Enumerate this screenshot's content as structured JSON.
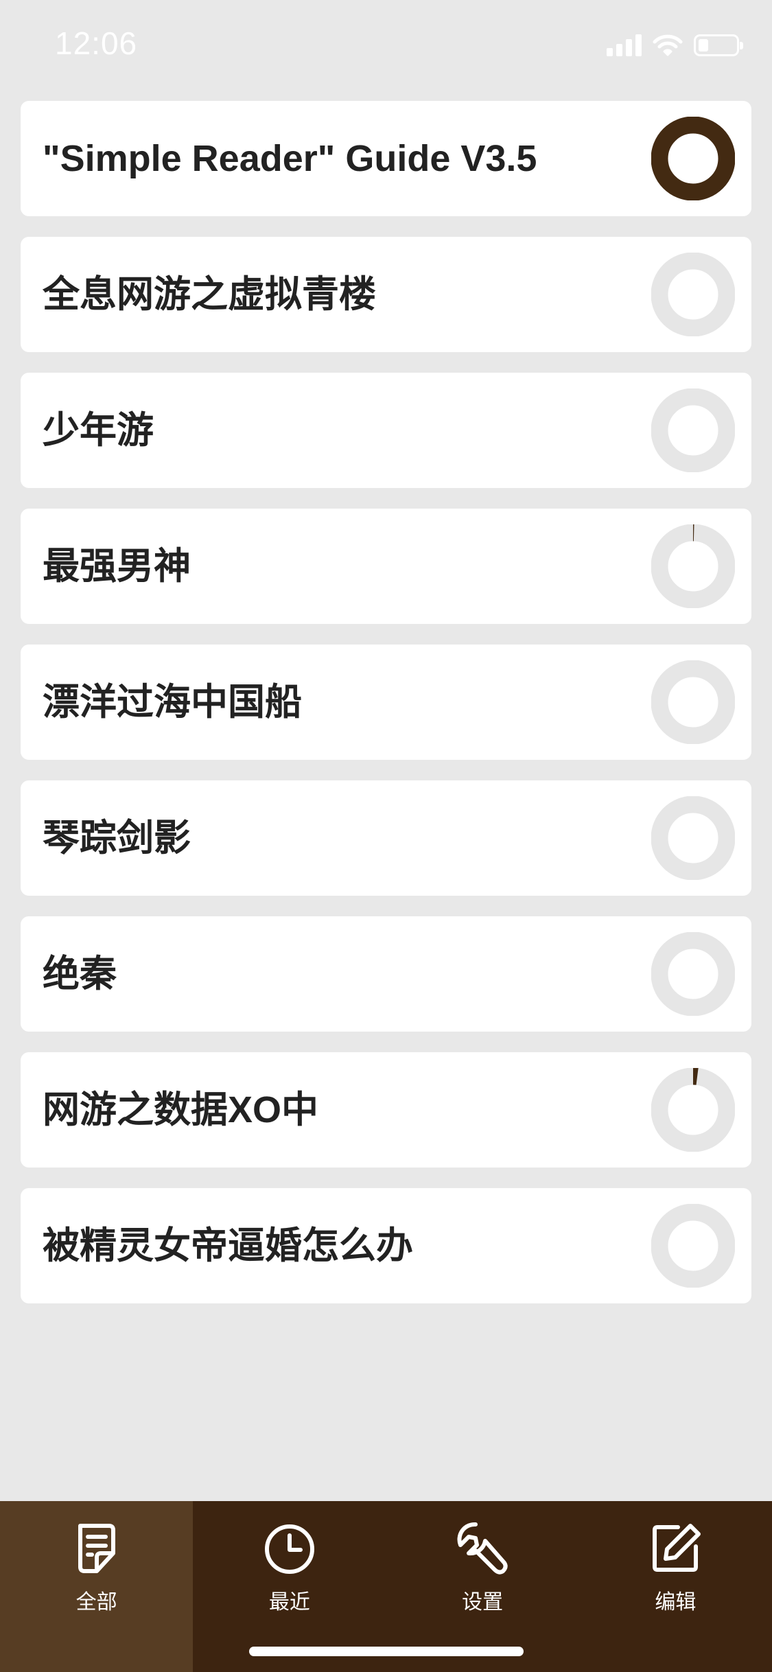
{
  "status_bar": {
    "time": "12:06",
    "icons": [
      "cellular-signal-icon",
      "wifi-icon",
      "battery-icon"
    ]
  },
  "books": [
    {
      "title": "\"Simple Reader\" Guide V3.5",
      "progress": 1.0
    },
    {
      "title": "全息网游之虚拟青楼",
      "progress": 0.0
    },
    {
      "title": "少年游",
      "progress": 0.0
    },
    {
      "title": "最强男神",
      "progress": 0.004
    },
    {
      "title": "漂洋过海中国船",
      "progress": 0.0
    },
    {
      "title": "琴踪剑影",
      "progress": 0.0
    },
    {
      "title": "绝秦",
      "progress": 0.0
    },
    {
      "title": "网游之数据XO中",
      "progress": 0.02
    },
    {
      "title": "被精灵女帝逼婚怎么办",
      "progress": 0.0
    }
  ],
  "colors": {
    "background": "#e8e8e8",
    "card": "#ffffff",
    "ring_track": "#e6e6e6",
    "ring_fill": "#432a12",
    "tab_bar": "#3d2410",
    "tab_active": "#573d23"
  },
  "tabs": [
    {
      "label": "全部",
      "icon": "document-list-icon",
      "active": true
    },
    {
      "label": "最近",
      "icon": "clock-icon",
      "active": false
    },
    {
      "label": "设置",
      "icon": "wrench-icon",
      "active": false
    },
    {
      "label": "编辑",
      "icon": "edit-icon",
      "active": false
    }
  ]
}
